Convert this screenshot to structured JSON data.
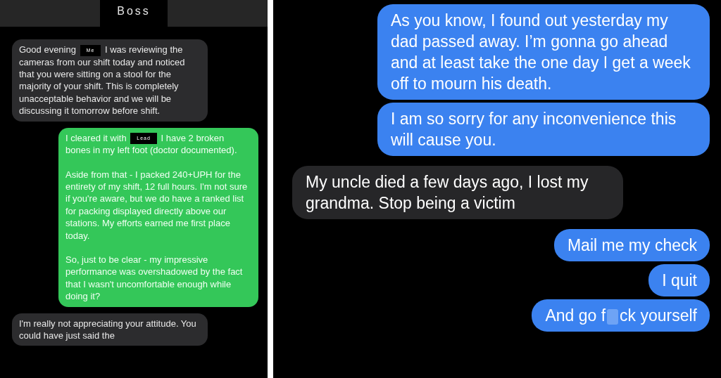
{
  "left_chat": {
    "title": "Boss",
    "messages": [
      {
        "kind": "incoming",
        "paragraphs": [
          [
            {
              "kind": "text",
              "text": "Good evening"
            },
            {
              "kind": "redaction",
              "text": "Me"
            },
            {
              "kind": "text",
              "text": "I was reviewing the cameras from our shift today and noticed that you were sitting on a stool for the majority of your shift. This is completely unacceptable behavior and we will be discussing it tomorrow before shift."
            }
          ]
        ]
      },
      {
        "kind": "outgoing",
        "paragraphs": [
          [
            {
              "kind": "text",
              "text": "I cleared it with"
            },
            {
              "kind": "redaction",
              "text": "Lead"
            },
            {
              "kind": "text",
              "text": "I have 2 broken bones in my left foot (doctor documented)."
            }
          ],
          [
            {
              "kind": "text",
              "text": "Aside from that - I packed 240+UPH for the entirety of my shift, 12 full hours. I'm not sure if you're aware, but we do have a ranked list for packing displayed directly above our stations. My efforts earned me first place today."
            }
          ],
          [
            {
              "kind": "text",
              "text": "So, just to be clear - my impressive performance was overshadowed by the fact that I wasn't uncomfortable enough while doing it?"
            }
          ]
        ]
      },
      {
        "kind": "incoming",
        "paragraphs": [
          [
            {
              "kind": "text",
              "text": "I'm really not appreciating your attitude. You could have just said the"
            }
          ]
        ]
      }
    ]
  },
  "right_chat": {
    "messages": [
      {
        "kind": "outgoing",
        "parts": [
          {
            "kind": "text",
            "text": "As you know, I found out yesterday my dad passed away. I’m gonna go ahead and at least take the one day I get a week off to mourn his death."
          }
        ]
      },
      {
        "kind": "outgoing",
        "parts": [
          {
            "kind": "text",
            "text": "I am so sorry for any inconvenience this will cause you."
          }
        ]
      },
      {
        "kind": "incoming",
        "parts": [
          {
            "kind": "text",
            "text": "My uncle died a few days ago, I lost my grandma. Stop being a victim"
          }
        ]
      },
      {
        "kind": "outgoing",
        "parts": [
          {
            "kind": "text",
            "text": "Mail me my check"
          }
        ]
      },
      {
        "kind": "outgoing",
        "parts": [
          {
            "kind": "text",
            "text": "I quit"
          }
        ]
      },
      {
        "kind": "outgoing",
        "parts": [
          {
            "kind": "text",
            "text": "And go f"
          },
          {
            "kind": "blur"
          },
          {
            "kind": "text",
            "text": "ck yourself"
          }
        ]
      }
    ]
  }
}
